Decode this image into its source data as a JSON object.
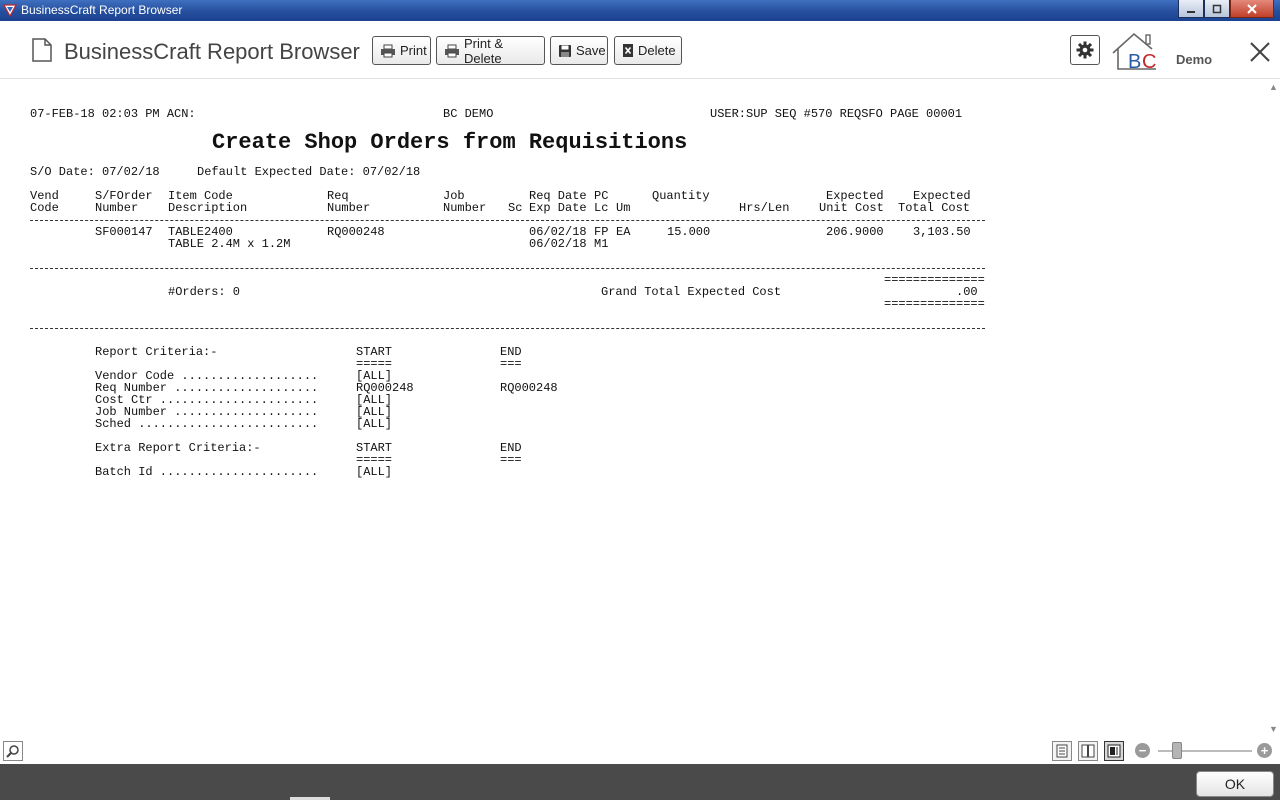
{
  "window": {
    "title": "BusinessCraft Report Browser",
    "controls": {
      "minimize": "minimize-icon",
      "maximize": "maximize-icon",
      "close": "close-icon"
    }
  },
  "toolbar": {
    "app_title": "BusinessCraft Report Browser",
    "print_label": "Print",
    "print_delete_label": "Print & Delete",
    "save_label": "Save",
    "delete_label": "Delete",
    "logo_text": "BC",
    "logo_caption": "Demo"
  },
  "report": {
    "header": {
      "datetime": "07-FEB-18 02:03 PM ACN:",
      "company": "BC DEMO",
      "user_info": "USER:SUP SEQ #570 REQSFO PAGE 00001"
    },
    "title": "Create Shop Orders from Requisitions",
    "so_date": "S/O Date: 07/02/18",
    "default_expected": "Default Expected Date: 07/02/18",
    "columns": [
      {
        "key": "vend",
        "line1": "Vend",
        "line2": "Code"
      },
      {
        "key": "sfo",
        "line1": "S/FOrder",
        "line2": "Number"
      },
      {
        "key": "item",
        "line1": "Item Code",
        "line2": "Description"
      },
      {
        "key": "req",
        "line1": "Req",
        "line2": "Number"
      },
      {
        "key": "job",
        "line1": "Job",
        "line2": "Number"
      },
      {
        "key": "sc",
        "line1": "",
        "line2": "Sc"
      },
      {
        "key": "dates",
        "line1": "Req Date",
        "line2": "Exp Date"
      },
      {
        "key": "pclc",
        "line1": "PC",
        "line2": "Lc"
      },
      {
        "key": "um",
        "line1": "",
        "line2": "Um"
      },
      {
        "key": "qty",
        "line1": "Quantity",
        "line2": ""
      },
      {
        "key": "hrs",
        "line1": "",
        "line2": "Hrs/Len"
      },
      {
        "key": "unit",
        "line1": "Expected",
        "line2": "Unit Cost"
      },
      {
        "key": "total",
        "line1": "Expected",
        "line2": "Total Cost"
      }
    ],
    "rows": [
      {
        "sfo": "SF000147",
        "item_code": "TABLE2400",
        "description": "TABLE 2.4M x 1.2M",
        "req": "RQ000248",
        "req_date": "06/02/18",
        "exp_date": "06/02/18",
        "pc": "FP",
        "lc": "M1",
        "um": "EA",
        "quantity": "15.000",
        "unit_cost": "206.9000",
        "total_cost": "3,103.50"
      }
    ],
    "totals": {
      "orders": "#Orders: 0",
      "grand_total_label": "Grand Total Expected Cost",
      "grand_total_value": ".00",
      "double_rule": "=============="
    },
    "criteria": {
      "title": "Report Criteria:-",
      "start_label": "START",
      "end_label": "END",
      "start_rule": "=====",
      "end_rule": "===",
      "items": [
        {
          "label": "Vendor Code ...................",
          "start": "[ALL]",
          "end": ""
        },
        {
          "label": "Req Number ....................",
          "start": "RQ000248",
          "end": "RQ000248"
        },
        {
          "label": "Cost Ctr ......................",
          "start": "[ALL]",
          "end": ""
        },
        {
          "label": "Job Number ....................",
          "start": "[ALL]",
          "end": ""
        },
        {
          "label": "Sched .........................",
          "start": "[ALL]",
          "end": ""
        }
      ]
    },
    "extra_criteria": {
      "title": "Extra Report Criteria:-",
      "start_label": "START",
      "end_label": "END",
      "start_rule": "=====",
      "end_rule": "===",
      "items": [
        {
          "label": "Batch Id ......................",
          "start": "[ALL]",
          "end": ""
        }
      ]
    }
  },
  "bottom": {
    "ok_label": "OK",
    "zoom_minus": "−",
    "zoom_plus": "+",
    "zoom_level": 0.2
  }
}
